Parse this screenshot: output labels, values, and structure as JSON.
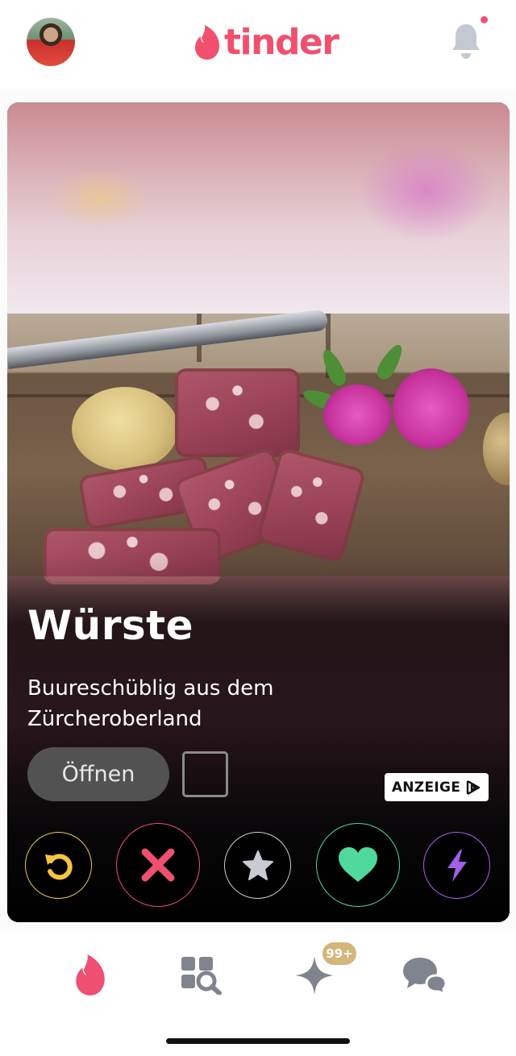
{
  "header": {
    "logo_text": "tinder",
    "has_notification_dot": true
  },
  "card": {
    "title": "Würste",
    "description": "Buureschüblig aus dem Zürcheroberland",
    "open_label": "Öffnen",
    "ad_label": "ANZEIGE"
  },
  "actions": {
    "icons": [
      "rewind-icon",
      "nope-icon",
      "super-like-icon",
      "like-icon",
      "boost-icon"
    ]
  },
  "bottom_nav": {
    "likes_badge": "99+",
    "items": [
      "fire-icon",
      "explore-icon",
      "likes-you-icon",
      "messages-icon"
    ]
  },
  "colors": {
    "brand": "#f0506e",
    "rewind": "#f5c542",
    "nope": "#f0506e",
    "super_like": "#c9cbd2",
    "like": "#4fd99a",
    "boost": "#a360e8",
    "nav_inactive": "#80848e",
    "badge": "#d4b57a"
  }
}
